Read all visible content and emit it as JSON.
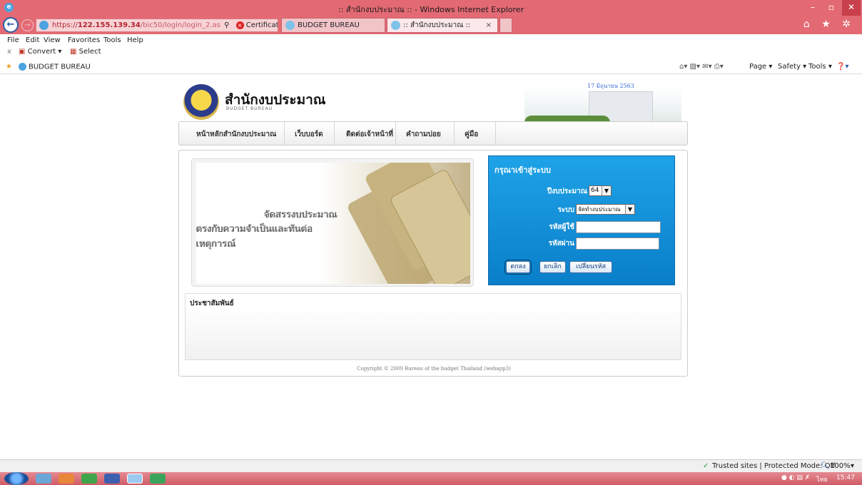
{
  "window": {
    "title": ":: สำนักงบประมาณ :: - Windows Internet Explorer",
    "controls": [
      "–",
      "▫",
      "✕"
    ]
  },
  "address": {
    "url_prefix": "https://",
    "url_host": "122.155.139.34",
    "url_path": "/bic50/login/login_2.as",
    "search_glyph": "⚲",
    "cert_label": "Certificate error",
    "refresh_glyphs": "▤ C"
  },
  "tabs": [
    {
      "label": "BUDGET BUREAU"
    },
    {
      "label": ":: สำนักงบประมาณ ::",
      "close": "×"
    }
  ],
  "toolbar_right_icons": "⌂ ★ ✲",
  "menu": [
    "File",
    "Edit",
    "View",
    "Favorites",
    "Tools",
    "Help"
  ],
  "command_bar": {
    "close": "x",
    "convert": "Convert",
    "select": "Select"
  },
  "favorites": {
    "item": "BUDGET BUREAU"
  },
  "ie_commands": [
    "Page ▾",
    "Safety ▾",
    "Tools ▾",
    "❓▾"
  ],
  "site": {
    "brand": "สำนักงบประมาณ",
    "brand_sub": "BUDGET BUREAU",
    "date": "17 มิถุนายน 2563",
    "nav": [
      "หน้าหลักสำนักงบประมาณ",
      "เว็บบอร์ด",
      "ติดต่อเจ้าหน้าที่",
      "คำถามบ่อย",
      "คู่มือ"
    ],
    "banner": {
      "line1": "จัดสรรงบประมาณ",
      "line2": "ตรงกับความจำเป็นและทันต่อเหตุการณ์"
    },
    "login": {
      "header": "กรุณาเข้าสู่ระบบ",
      "year_label": "ปีงบประมาณ",
      "year_value": "64",
      "system_label": "ระบบ",
      "system_value": "จัดทำงบประมาณ",
      "user_label": "รหัสผู้ใช้",
      "user_value": "",
      "pass_label": "รหัสผ่าน",
      "pass_value": "",
      "ok": "ตกลง",
      "cancel": "ยกเลิก",
      "change_password": "เปลี่ยนรหัส"
    },
    "pr_title": "ประชาสัมพันธ์",
    "copyright": "Copyright © 2009 Bureau of the budget Thailand (webapp3)"
  },
  "status": {
    "zone": "Trusted sites | Protected Mode: Off",
    "zoom": "100%"
  },
  "taskbar": {
    "lang": "ไทย",
    "time": "15:47"
  }
}
